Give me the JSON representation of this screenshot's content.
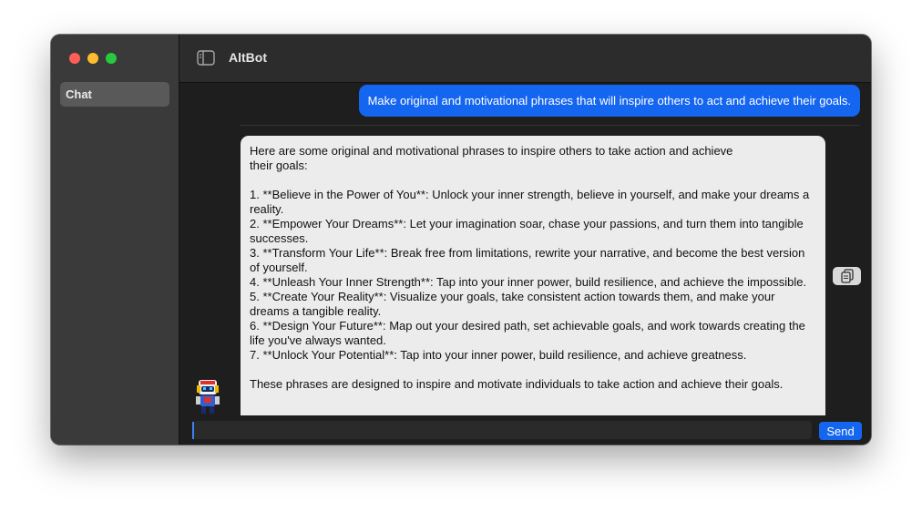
{
  "window": {
    "app_title": "AltBot"
  },
  "sidebar": {
    "items": [
      {
        "label": "Chat",
        "selected": true
      }
    ]
  },
  "chat": {
    "user_message": "Make original and motivational phrases that will inspire others to act and achieve their goals.",
    "bot_message": "Here are some original and motivational phrases to inspire others to take action and achieve\ntheir goals:\n\n1. **Believe in the Power of You**: Unlock your inner strength, believe in yourself, and make your dreams a reality.\n2. **Empower Your Dreams**: Let your imagination soar, chase your passions, and turn them into tangible successes.\n3. **Transform Your Life**: Break free from limitations, rewrite your narrative, and become the best version of yourself.\n4. **Unleash Your Inner Strength**: Tap into your inner power, build resilience, and achieve the impossible.\n5. **Create Your Reality**: Visualize your goals, take consistent action towards them, and make your dreams a tangible reality.\n6. **Design Your Future**: Map out your desired path, set achievable goals, and work towards creating the life you've always wanted.\n7. **Unlock Your Potential**: Tap into your inner power, build resilience, and achieve greatness.\n\nThese phrases are designed to inspire and motivate individuals to take action and achieve their goals."
  },
  "composer": {
    "input_value": "",
    "send_label": "Send"
  },
  "icons": {
    "sidebar_toggle": "sidebar-toggle-icon",
    "copy": "copy-icon",
    "avatar": "robot-avatar"
  },
  "colors": {
    "accent": "#1466f0",
    "sidebar_bg": "#3a3a3a",
    "chat_bg": "#1e1e1e",
    "bot_bubble": "#ececec"
  }
}
